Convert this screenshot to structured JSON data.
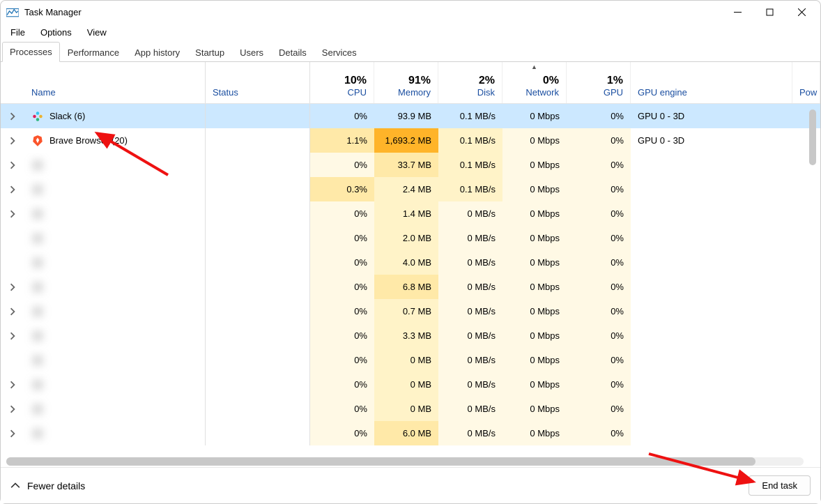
{
  "window": {
    "title": "Task Manager"
  },
  "menu": [
    "File",
    "Options",
    "View"
  ],
  "tabs": [
    "Processes",
    "Performance",
    "App history",
    "Startup",
    "Users",
    "Details",
    "Services"
  ],
  "active_tab": 0,
  "columns": {
    "name": "Name",
    "status": "Status",
    "cpu": {
      "pct": "10%",
      "label": "CPU"
    },
    "mem": {
      "pct": "91%",
      "label": "Memory"
    },
    "disk": {
      "pct": "2%",
      "label": "Disk"
    },
    "net": {
      "pct": "0%",
      "label": "Network"
    },
    "gpu": {
      "pct": "1%",
      "label": "GPU"
    },
    "gpueng": "GPU engine",
    "power": "Pow"
  },
  "rows": [
    {
      "expandable": true,
      "selected": true,
      "icon": "slack",
      "name": "Slack (6)",
      "cpu": "0%",
      "mem": "93.9 MB",
      "disk": "0.1 MB/s",
      "net": "0 Mbps",
      "gpu": "0%",
      "gpueng": "GPU 0 - 3D",
      "heat": {
        "cpu": 0,
        "mem": 2,
        "disk": 1,
        "net": 0,
        "gpu": 0
      }
    },
    {
      "expandable": true,
      "selected": false,
      "icon": "brave",
      "name": "Brave Browser (20)",
      "cpu": "1.1%",
      "mem": "1,693.2 MB",
      "disk": "0.1 MB/s",
      "net": "0 Mbps",
      "gpu": "0%",
      "gpueng": "GPU 0 - 3D",
      "heat": {
        "cpu": 2,
        "mem": 5,
        "disk": 1,
        "net": 0,
        "gpu": 0
      }
    },
    {
      "expandable": true,
      "blurred": true,
      "cpu": "0%",
      "mem": "33.7 MB",
      "disk": "0.1 MB/s",
      "net": "0 Mbps",
      "gpu": "0%",
      "gpueng": "",
      "heat": {
        "cpu": 0,
        "mem": 2,
        "disk": 1,
        "net": 0,
        "gpu": 0
      }
    },
    {
      "expandable": true,
      "blurred": true,
      "cpu": "0.3%",
      "mem": "2.4 MB",
      "disk": "0.1 MB/s",
      "net": "0 Mbps",
      "gpu": "0%",
      "gpueng": "",
      "heat": {
        "cpu": 2,
        "mem": 1,
        "disk": 1,
        "net": 0,
        "gpu": 0
      }
    },
    {
      "expandable": true,
      "blurred": true,
      "cpu": "0%",
      "mem": "1.4 MB",
      "disk": "0 MB/s",
      "net": "0 Mbps",
      "gpu": "0%",
      "gpueng": "",
      "heat": {
        "cpu": 0,
        "mem": 1,
        "disk": 0,
        "net": 0,
        "gpu": 0
      }
    },
    {
      "expandable": false,
      "blurred": true,
      "cpu": "0%",
      "mem": "2.0 MB",
      "disk": "0 MB/s",
      "net": "0 Mbps",
      "gpu": "0%",
      "gpueng": "",
      "heat": {
        "cpu": 0,
        "mem": 1,
        "disk": 0,
        "net": 0,
        "gpu": 0
      }
    },
    {
      "expandable": false,
      "blurred": true,
      "cpu": "0%",
      "mem": "4.0 MB",
      "disk": "0 MB/s",
      "net": "0 Mbps",
      "gpu": "0%",
      "gpueng": "",
      "heat": {
        "cpu": 0,
        "mem": 1,
        "disk": 0,
        "net": 0,
        "gpu": 0
      }
    },
    {
      "expandable": true,
      "blurred": true,
      "cpu": "0%",
      "mem": "6.8 MB",
      "disk": "0 MB/s",
      "net": "0 Mbps",
      "gpu": "0%",
      "gpueng": "",
      "heat": {
        "cpu": 0,
        "mem": 2,
        "disk": 0,
        "net": 0,
        "gpu": 0
      }
    },
    {
      "expandable": true,
      "blurred": true,
      "cpu": "0%",
      "mem": "0.7 MB",
      "disk": "0 MB/s",
      "net": "0 Mbps",
      "gpu": "0%",
      "gpueng": "",
      "heat": {
        "cpu": 0,
        "mem": 1,
        "disk": 0,
        "net": 0,
        "gpu": 0
      }
    },
    {
      "expandable": true,
      "blurred": true,
      "cpu": "0%",
      "mem": "3.3 MB",
      "disk": "0 MB/s",
      "net": "0 Mbps",
      "gpu": "0%",
      "gpueng": "",
      "heat": {
        "cpu": 0,
        "mem": 1,
        "disk": 0,
        "net": 0,
        "gpu": 0
      }
    },
    {
      "expandable": false,
      "blurred": true,
      "cpu": "0%",
      "mem": "0 MB",
      "disk": "0 MB/s",
      "net": "0 Mbps",
      "gpu": "0%",
      "gpueng": "",
      "heat": {
        "cpu": 0,
        "mem": 1,
        "disk": 0,
        "net": 0,
        "gpu": 0
      }
    },
    {
      "expandable": true,
      "blurred": true,
      "cpu": "0%",
      "mem": "0 MB",
      "disk": "0 MB/s",
      "net": "0 Mbps",
      "gpu": "0%",
      "gpueng": "",
      "heat": {
        "cpu": 0,
        "mem": 1,
        "disk": 0,
        "net": 0,
        "gpu": 0
      }
    },
    {
      "expandable": true,
      "blurred": true,
      "cpu": "0%",
      "mem": "0 MB",
      "disk": "0 MB/s",
      "net": "0 Mbps",
      "gpu": "0%",
      "gpueng": "",
      "heat": {
        "cpu": 0,
        "mem": 1,
        "disk": 0,
        "net": 0,
        "gpu": 0
      }
    },
    {
      "expandable": true,
      "blurred": true,
      "cpu": "0%",
      "mem": "6.0 MB",
      "disk": "0 MB/s",
      "net": "0 Mbps",
      "gpu": "0%",
      "gpueng": "",
      "heat": {
        "cpu": 0,
        "mem": 2,
        "disk": 0,
        "net": 0,
        "gpu": 0
      }
    }
  ],
  "footer": {
    "fewer_details": "Fewer details",
    "end_task": "End task"
  }
}
